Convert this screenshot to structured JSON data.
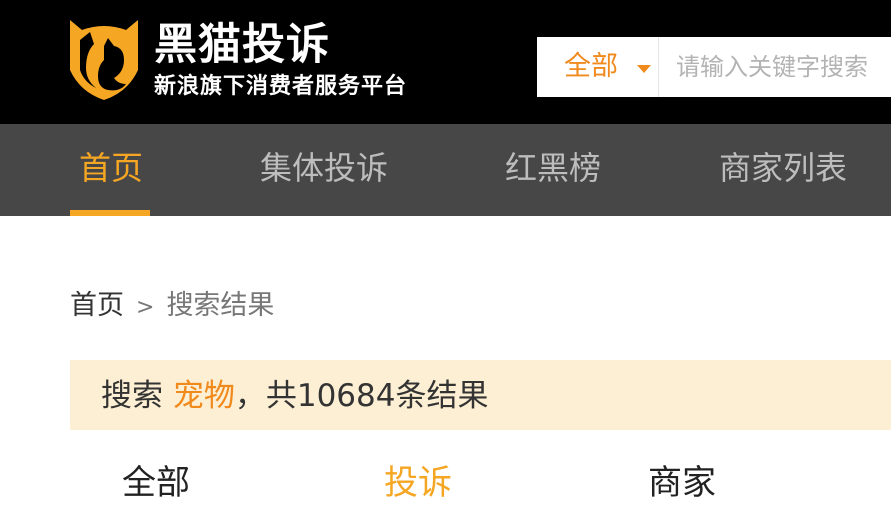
{
  "header": {
    "brand_title": "黑猫投诉",
    "brand_subtitle": "新浪旗下消费者服务平台",
    "logo_icon": "black-cat-shield-icon"
  },
  "search": {
    "scope_label": "全部",
    "placeholder": "请输入关键字搜索",
    "value": ""
  },
  "nav": {
    "items": [
      {
        "label": "首页",
        "active": true
      },
      {
        "label": "集体投诉",
        "active": false
      },
      {
        "label": "红黑榜",
        "active": false
      },
      {
        "label": "商家列表",
        "active": false
      }
    ]
  },
  "breadcrumb": {
    "home": "首页",
    "separator": ">",
    "current": "搜索结果"
  },
  "result_summary": {
    "prefix": "搜索 ",
    "keyword": "宠物",
    "suffix": "，共10684条结果"
  },
  "tabs": {
    "items": [
      {
        "label": "全部",
        "active": false
      },
      {
        "label": "投诉",
        "active": true
      },
      {
        "label": "商家",
        "active": false
      }
    ]
  },
  "colors": {
    "accent": "#f5a623",
    "keyword": "#f08a1c",
    "header_bg": "#000000",
    "nav_bg": "#474747",
    "result_bar_bg": "#fdefd3"
  }
}
